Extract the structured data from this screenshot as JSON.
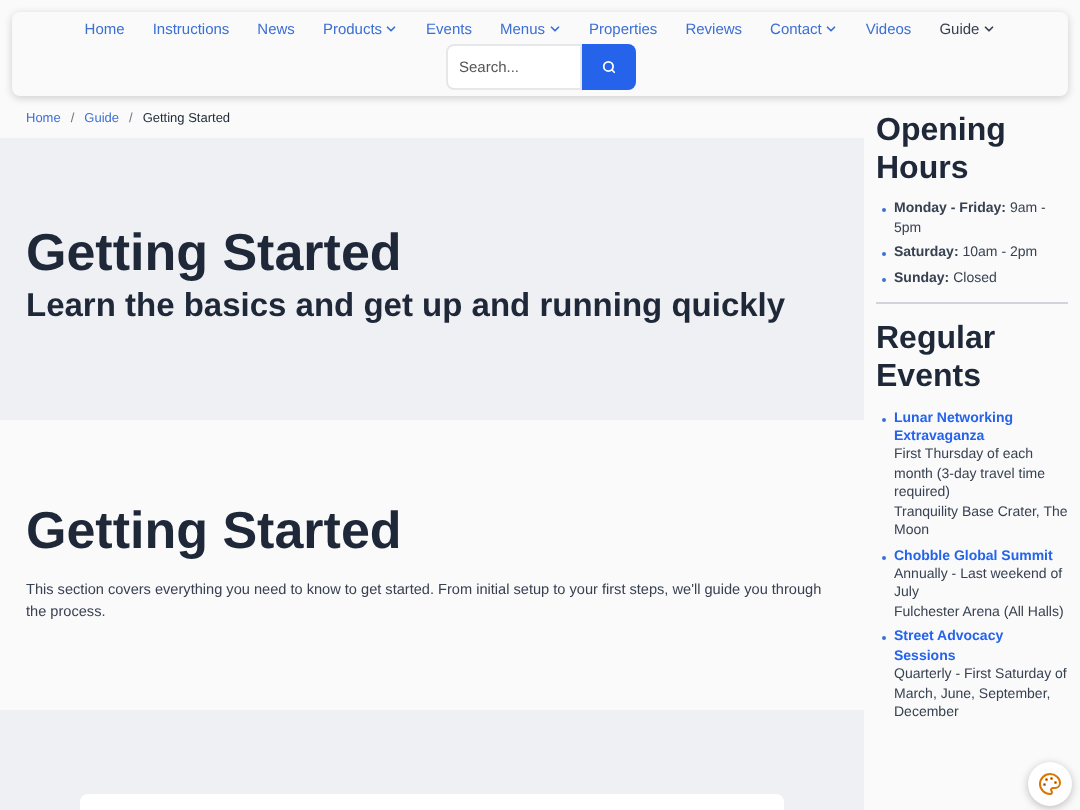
{
  "nav": {
    "items": [
      {
        "label": "Home",
        "dropdown": false,
        "current": false
      },
      {
        "label": "Instructions",
        "dropdown": false,
        "current": false
      },
      {
        "label": "News",
        "dropdown": false,
        "current": false
      },
      {
        "label": "Products",
        "dropdown": true,
        "current": false
      },
      {
        "label": "Events",
        "dropdown": false,
        "current": false
      },
      {
        "label": "Menus",
        "dropdown": true,
        "current": false
      },
      {
        "label": "Properties",
        "dropdown": false,
        "current": false
      },
      {
        "label": "Reviews",
        "dropdown": false,
        "current": false
      },
      {
        "label": "Contact",
        "dropdown": true,
        "current": false
      },
      {
        "label": "Videos",
        "dropdown": false,
        "current": false
      },
      {
        "label": "Guide",
        "dropdown": true,
        "current": true
      }
    ],
    "search": {
      "placeholder": "Search..."
    }
  },
  "breadcrumb": [
    {
      "label": "Home",
      "current": false
    },
    {
      "label": "Guide",
      "current": false
    },
    {
      "label": "Getting Started",
      "current": true
    }
  ],
  "breadcrumb_separator": "/",
  "hero": {
    "title": "Getting Started",
    "subtitle": "Learn the basics and get up and running quickly"
  },
  "section": {
    "title": "Getting Started",
    "text": "This section covers everything you need to know to get started. From initial setup to your first steps, we'll guide you through the process."
  },
  "sidebar": {
    "hours_title": "Opening Hours",
    "hours": [
      {
        "day": "Monday - Friday:",
        "time": "9am - 5pm"
      },
      {
        "day": "Saturday:",
        "time": "10am - 2pm"
      },
      {
        "day": "Sunday:",
        "time": "Closed"
      }
    ],
    "events_title": "Regular Events",
    "events": [
      {
        "name": "Lunar Networking Extravaganza",
        "lines": [
          "First Thursday of each month (3-day travel time required)",
          "Tranquility Base Crater, The Moon"
        ]
      },
      {
        "name": "Chobble Global Summit",
        "lines": [
          "Annually - Last weekend of July",
          "Fulchester Arena (All Halls)"
        ]
      },
      {
        "name": "Street Advocacy Sessions",
        "lines": [
          "Quarterly - First Saturday of March, June, September, December"
        ]
      }
    ]
  }
}
